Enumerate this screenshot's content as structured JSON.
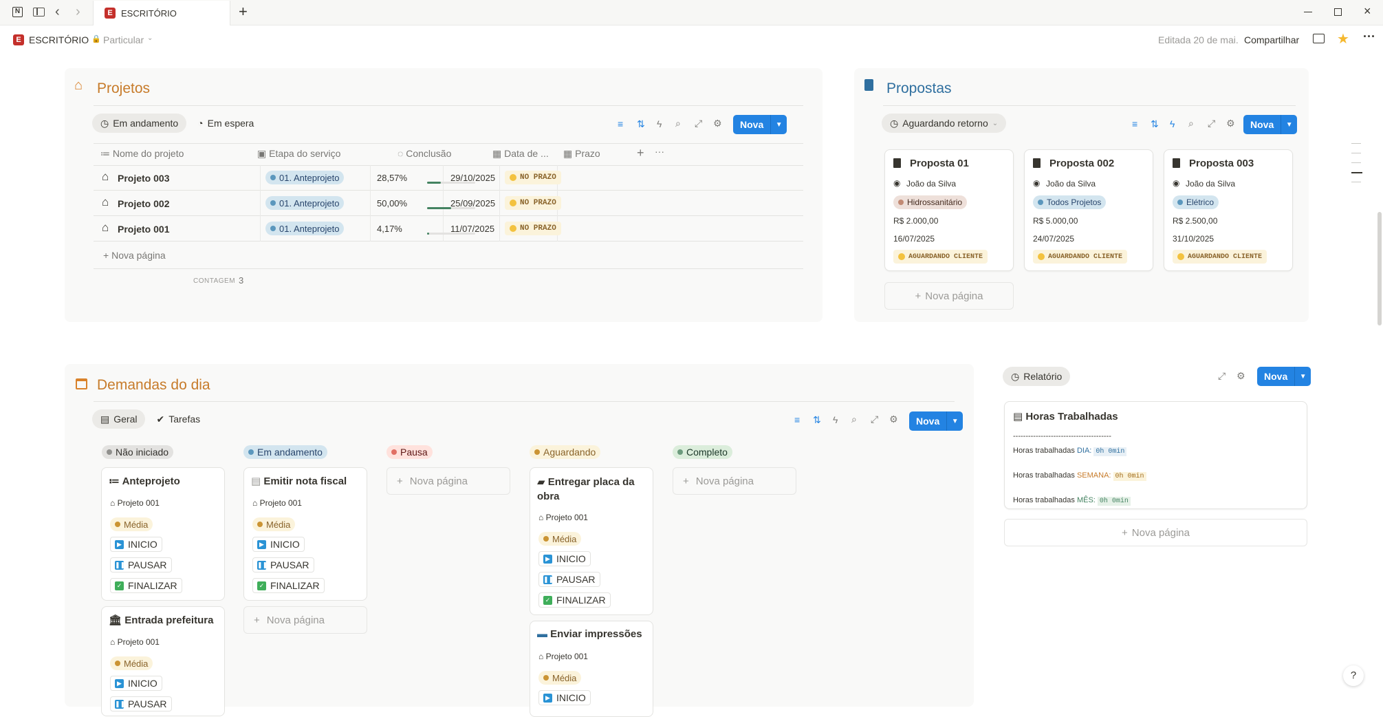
{
  "window": {
    "tab_title": "ESCRITÓRIO",
    "breadcrumb_page": "ESCRITÓRIO",
    "breadcrumb_workspace": "Particular",
    "edited": "Editada 20 de mai.",
    "share": "Compartilhar"
  },
  "projetos": {
    "title": "Projetos",
    "views": [
      "Em andamento",
      "Em espera"
    ],
    "new_label": "Nova",
    "columns": [
      "Nome do projeto",
      "Etapa do serviço",
      "Conclusão",
      "Data de ...",
      "Prazo"
    ],
    "rows": [
      {
        "name": "Projeto 003",
        "etapa": "01. Anteprojeto",
        "conclusao": "28,57%",
        "progress": 0.2857,
        "data": "29/10/2025",
        "prazo": "NO PRAZO"
      },
      {
        "name": "Projeto 002",
        "etapa": "01. Anteprojeto",
        "conclusao": "50,00%",
        "progress": 0.5,
        "data": "25/09/2025",
        "prazo": "NO PRAZO"
      },
      {
        "name": "Projeto 001",
        "etapa": "01. Anteprojeto",
        "conclusao": "4,17%",
        "progress": 0.0417,
        "data": "11/07/2025",
        "prazo": "NO PRAZO"
      }
    ],
    "new_page": "Nova página",
    "count_label": "CONTAGEM",
    "count_value": "3"
  },
  "propostas": {
    "title": "Propostas",
    "view": "Aguardando retorno",
    "new_label": "Nova",
    "cards": [
      {
        "title": "Proposta 01",
        "person": "João da Silva",
        "category": "Hidrossanitário",
        "value": "R$ 2.000,00",
        "date": "16/07/2025",
        "status": "AGUARDANDO CLIENTE"
      },
      {
        "title": "Proposta 002",
        "person": "João da Silva",
        "category": "Todos Projetos",
        "value": "R$ 5.000,00",
        "date": "24/07/2025",
        "status": "AGUARDANDO CLIENTE"
      },
      {
        "title": "Proposta 003",
        "person": "João da Silva",
        "category": "Elétrico",
        "value": "R$ 2.500,00",
        "date": "31/10/2025",
        "status": "AGUARDANDO CLIENTE"
      }
    ],
    "new_page": "Nova página"
  },
  "demandas": {
    "title": "Demandas do dia",
    "views": [
      "Geral",
      "Tarefas"
    ],
    "new_label": "Nova",
    "groups": [
      "Não iniciado",
      "Em andamento",
      "Pausa",
      "Aguardando",
      "Completo"
    ],
    "btn_inicio": "INICIO",
    "btn_pausar": "PAUSAR",
    "btn_finalizar": "FINALIZAR",
    "priority": "Média",
    "project": "Projeto 001",
    "cards": {
      "c1": "Anteprojeto",
      "c2": "Entrada prefeitura",
      "c3": "Emitir nota fiscal",
      "c4": "Entregar placa da obra",
      "c5": "Enviar impressões"
    },
    "new_page": "Nova página"
  },
  "relatorio": {
    "view": "Relatório",
    "new_label": "Nova",
    "card_title": "Horas Trabalhadas",
    "divider": "---------------------------------------",
    "line1_label": "Horas trabalhadas",
    "line1_key": "DIA:",
    "line1_value": "0h 0min",
    "line2_label": "Horas trabalhadas",
    "line2_key": "SEMANA:",
    "line2_value": "0h 0min",
    "line3_label": "Horas trabalhadas",
    "line3_key": "MÊS:",
    "line3_value": "0h 0min",
    "new_page": "Nova página"
  },
  "colors": {
    "accent": "#2383e2",
    "section_title_orange": "#c77b2a",
    "section_title_blue": "#2f6f9f"
  }
}
